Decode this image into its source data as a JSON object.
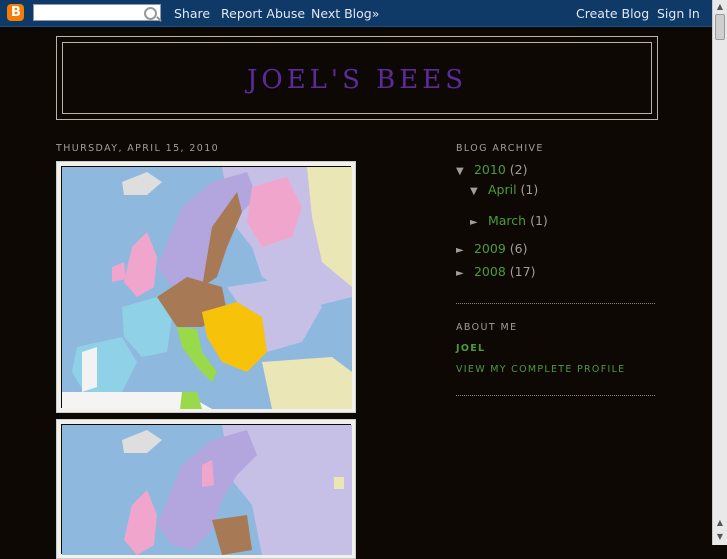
{
  "navbar": {
    "search_placeholder": "",
    "links": [
      "Share",
      "Report Abuse",
      "Next Blog»"
    ],
    "right_links": [
      "Create Blog",
      "Sign In"
    ]
  },
  "header": {
    "title": "JOEL'S BEES"
  },
  "main": {
    "date": "THURSDAY, APRIL 15, 2010"
  },
  "sidebar": {
    "archive_heading": "BLOG ARCHIVE",
    "archive": [
      {
        "toggle": "▼",
        "label": "2010",
        "count": "(2)"
      },
      {
        "toggle": "▼",
        "label": "April",
        "count": "(1)"
      },
      {
        "toggle": "►",
        "label": "March",
        "count": "(1)"
      },
      {
        "toggle": "►",
        "label": "2009",
        "count": "(6)"
      },
      {
        "toggle": "►",
        "label": "2008",
        "count": "(17)"
      }
    ],
    "about_heading": "ABOUT ME",
    "profile_name": "JOEL",
    "profile_link": "VIEW MY COMPLETE PROFILE"
  },
  "colors": {
    "navbar": "#0f3966",
    "background": "#0e0805",
    "title": "#5b2b9c",
    "link": "#4d9a3d",
    "muted": "#a39d94"
  }
}
